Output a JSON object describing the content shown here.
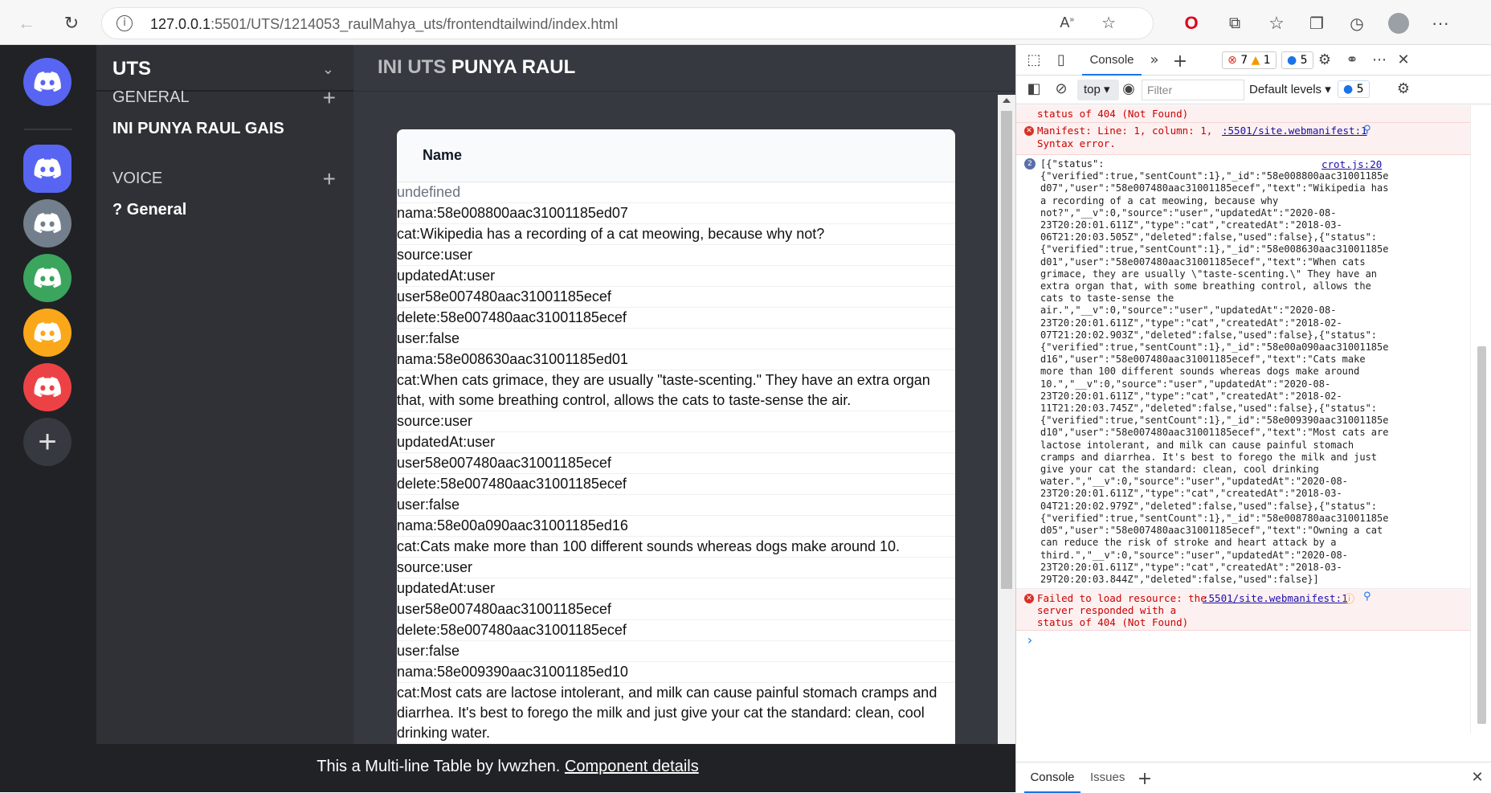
{
  "browser": {
    "url_host": "127.0.0.1",
    "url_path": ":5501/UTS/1214053_raulMahya_uts/frontendtailwind/index.html"
  },
  "colors": {
    "server_blue": "#5865f2",
    "server_gray": "#747f8d",
    "server_green": "#3ba55d",
    "server_yellow": "#faa81a",
    "server_red": "#ed4245",
    "add_server_bg": "#36393f"
  },
  "sidebar": {
    "title": "UTS",
    "categories": [
      {
        "label": "GENERAL",
        "channel": "INI PUNYA RAUL GAIS"
      },
      {
        "label": "VOICE",
        "channel": "? General"
      }
    ]
  },
  "main": {
    "title_a": "INI UTS",
    "title_b": "PUNYA RAUL",
    "table": {
      "header": "Name",
      "rows": [
        "undefined",
        "nama:58e008800aac31001185ed07",
        "cat:Wikipedia has a recording of a cat meowing, because why not?",
        "source:user",
        "updatedAt:user",
        "user58e007480aac31001185ecef",
        "delete:58e007480aac31001185ecef",
        "user:false",
        "nama:58e008630aac31001185ed01",
        "cat:When cats grimace, they are usually \"taste-scenting.\" They have an extra organ that, with some breathing control, allows the cats to taste-sense the air.",
        "source:user",
        "updatedAt:user",
        "user58e007480aac31001185ecef",
        "delete:58e007480aac31001185ecef",
        "user:false",
        "nama:58e00a090aac31001185ed16",
        "cat:Cats make more than 100 different sounds whereas dogs make around 10.",
        "source:user",
        "updatedAt:user",
        "user58e007480aac31001185ecef",
        "delete:58e007480aac31001185ecef",
        "user:false",
        "nama:58e009390aac31001185ed10",
        "cat:Most cats are lactose intolerant, and milk can cause painful stomach cramps and diarrhea. It's best to forego the milk and just give your cat the standard: clean, cool drinking water."
      ]
    }
  },
  "footer": {
    "text": "This a Multi-line Table by lvwzhen.",
    "link": "Component details"
  },
  "devtools": {
    "tab_console": "Console",
    "error_count": "7",
    "warn_count": "1",
    "info_count": "5",
    "context": "top",
    "filter_placeholder": "Filter",
    "levels": "Default levels",
    "levels_badge": "5",
    "msg1": "status of 404 (Not Found)",
    "msg2_text": "Manifest: Line: 1, column: 1,",
    "msg2_text2": "Syntax error.",
    "msg2_link": ":5501/site.webmanifest:1",
    "log_count": "2",
    "log_link": "crot.js:20",
    "log_lines": [
      "[{\"status\":",
      "{\"verified\":true,\"sentCount\":1},\"_id\":\"58e008800aac31001185e",
      "d07\",\"user\":\"58e007480aac31001185ecef\",\"text\":\"Wikipedia has",
      "a recording of a cat meowing, because why",
      "not?\",\"__v\":0,\"source\":\"user\",\"updatedAt\":\"2020-08-",
      "23T20:20:01.611Z\",\"type\":\"cat\",\"createdAt\":\"2018-03-",
      "06T21:20:03.505Z\",\"deleted\":false,\"used\":false},{\"status\":",
      "{\"verified\":true,\"sentCount\":1},\"_id\":\"58e008630aac31001185e",
      "d01\",\"user\":\"58e007480aac31001185ecef\",\"text\":\"When cats",
      "grimace, they are usually \\\"taste-scenting.\\\" They have an",
      "extra organ that, with some breathing control, allows the",
      "cats to taste-sense the",
      "air.\",\"__v\":0,\"source\":\"user\",\"updatedAt\":\"2020-08-",
      "23T20:20:01.611Z\",\"type\":\"cat\",\"createdAt\":\"2018-02-",
      "07T21:20:02.903Z\",\"deleted\":false,\"used\":false},{\"status\":",
      "{\"verified\":true,\"sentCount\":1},\"_id\":\"58e00a090aac31001185e",
      "d16\",\"user\":\"58e007480aac31001185ecef\",\"text\":\"Cats make",
      "more than 100 different sounds whereas dogs make around",
      "10.\",\"__v\":0,\"source\":\"user\",\"updatedAt\":\"2020-08-",
      "23T20:20:01.611Z\",\"type\":\"cat\",\"createdAt\":\"2018-02-",
      "11T21:20:03.745Z\",\"deleted\":false,\"used\":false},{\"status\":",
      "{\"verified\":true,\"sentCount\":1},\"_id\":\"58e009390aac31001185e",
      "d10\",\"user\":\"58e007480aac31001185ecef\",\"text\":\"Most cats are",
      "lactose intolerant, and milk can cause painful stomach",
      "cramps and diarrhea. It's best to forego the milk and just",
      "give your cat the standard: clean, cool drinking",
      "water.\",\"__v\":0,\"source\":\"user\",\"updatedAt\":\"2020-08-",
      "23T20:20:01.611Z\",\"type\":\"cat\",\"createdAt\":\"2018-03-",
      "04T21:20:02.979Z\",\"deleted\":false,\"used\":false},{\"status\":",
      "{\"verified\":true,\"sentCount\":1},\"_id\":\"58e008780aac31001185e",
      "d05\",\"user\":\"58e007480aac31001185ecef\",\"text\":\"Owning a cat",
      "can reduce the risk of stroke and heart attack by a",
      "third.\",\"__v\":0,\"source\":\"user\",\"updatedAt\":\"2020-08-",
      "23T20:20:01.611Z\",\"type\":\"cat\",\"createdAt\":\"2018-03-",
      "29T20:20:03.844Z\",\"deleted\":false,\"used\":false}]"
    ],
    "err3_l1": "Failed to load resource: the",
    "err3_l2": "server responded with a",
    "err3_l3": "status of 404 (Not Found)",
    "err3_link": ":5501/site.webmanifest:1",
    "prompt": "›",
    "bottom_console": "Console",
    "bottom_issues": "Issues"
  }
}
